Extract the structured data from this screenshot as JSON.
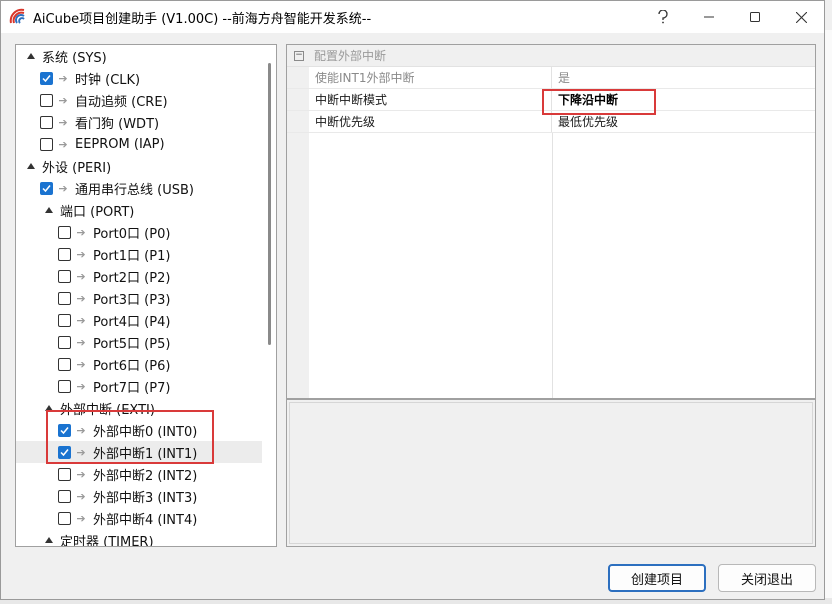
{
  "window": {
    "title": "AiCube项目创建助手 (V1.00C) --前海方舟智能开发系统--"
  },
  "tree": [
    {
      "level": 0,
      "expanded": true,
      "checkbox": false,
      "label": "系统 (SYS)"
    },
    {
      "level": 1,
      "checkbox": true,
      "checked": true,
      "label": "时钟 (CLK)"
    },
    {
      "level": 1,
      "checkbox": true,
      "checked": false,
      "label": "自动追频 (CRE)"
    },
    {
      "level": 1,
      "checkbox": true,
      "checked": false,
      "label": "看门狗 (WDT)"
    },
    {
      "level": 1,
      "checkbox": true,
      "checked": false,
      "label": "EEPROM (IAP)"
    },
    {
      "level": 0,
      "expanded": true,
      "checkbox": false,
      "label": "外设 (PERI)"
    },
    {
      "level": 1,
      "checkbox": true,
      "checked": true,
      "label": "通用串行总线 (USB)"
    },
    {
      "level": 1,
      "expanded": true,
      "checkbox": false,
      "label": "端口 (PORT)"
    },
    {
      "level": 2,
      "checkbox": true,
      "checked": false,
      "label": "Port0口 (P0)"
    },
    {
      "level": 2,
      "checkbox": true,
      "checked": false,
      "label": "Port1口 (P1)"
    },
    {
      "level": 2,
      "checkbox": true,
      "checked": false,
      "label": "Port2口 (P2)"
    },
    {
      "level": 2,
      "checkbox": true,
      "checked": false,
      "label": "Port3口 (P3)"
    },
    {
      "level": 2,
      "checkbox": true,
      "checked": false,
      "label": "Port4口 (P4)"
    },
    {
      "level": 2,
      "checkbox": true,
      "checked": false,
      "label": "Port5口 (P5)"
    },
    {
      "level": 2,
      "checkbox": true,
      "checked": false,
      "label": "Port6口 (P6)"
    },
    {
      "level": 2,
      "checkbox": true,
      "checked": false,
      "label": "Port7口 (P7)"
    },
    {
      "level": 1,
      "expanded": true,
      "checkbox": false,
      "label": "外部中断 (EXTI)"
    },
    {
      "level": 2,
      "checkbox": true,
      "checked": true,
      "label": "外部中断0 (INT0)"
    },
    {
      "level": 2,
      "checkbox": true,
      "checked": true,
      "label": "外部中断1 (INT1)",
      "selected": true
    },
    {
      "level": 2,
      "checkbox": true,
      "checked": false,
      "label": "外部中断2 (INT2)"
    },
    {
      "level": 2,
      "checkbox": true,
      "checked": false,
      "label": "外部中断3 (INT3)"
    },
    {
      "level": 2,
      "checkbox": true,
      "checked": false,
      "label": "外部中断4 (INT4)"
    },
    {
      "level": 1,
      "expanded": true,
      "checkbox": false,
      "label": "定时器 (TIMER)"
    }
  ],
  "properties": {
    "category": "配置外部中断",
    "rows": [
      {
        "name": "使能INT1外部中断",
        "value": "是",
        "disabled": true
      },
      {
        "name": "中断中断模式",
        "value": "下降沿中断",
        "bold": true
      },
      {
        "name": "中断优先级",
        "value": "最低优先级"
      }
    ]
  },
  "buttons": {
    "create": "创建项目",
    "close": "关闭退出"
  },
  "colors": {
    "checkbox_checked": "#1a73d0",
    "highlight": "#d93a3a",
    "primary_border": "#2c6fbf"
  },
  "icons": {
    "app": "aicube-logo-icon",
    "minimize": "minimize-icon",
    "maximize": "maximize-icon",
    "close": "close-icon"
  }
}
